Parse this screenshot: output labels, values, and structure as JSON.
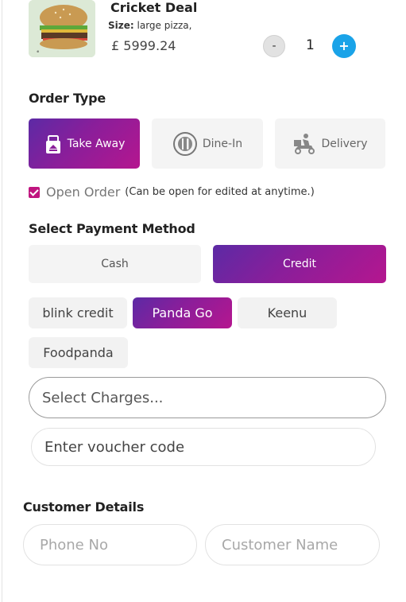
{
  "product": {
    "name": "Cricket Deal",
    "size_label": "Size:",
    "size_value": "large pizza,",
    "price": "£ 5999.24",
    "quantity": "1",
    "minus_label": "-",
    "plus_label": "+"
  },
  "order_type": {
    "title": "Order Type",
    "options": [
      {
        "label": "Take Away",
        "icon": "takeaway-bag-icon",
        "active": true
      },
      {
        "label": "Dine-In",
        "icon": "plate-fork-knife-icon",
        "active": false
      },
      {
        "label": "Delivery",
        "icon": "delivery-scooter-icon",
        "active": false
      }
    ]
  },
  "open_order": {
    "checked": true,
    "label": "Open Order",
    "note": "(Can be open for edited at anytime.)"
  },
  "payment": {
    "title": "Select Payment Method",
    "methods": [
      {
        "label": "Cash",
        "active": false
      },
      {
        "label": "Credit",
        "active": true
      }
    ],
    "credit_options": [
      {
        "label": "blink credit",
        "active": false
      },
      {
        "label": "Panda Go",
        "active": true
      },
      {
        "label": "Keenu",
        "active": false
      },
      {
        "label": "Foodpanda",
        "active": false
      }
    ]
  },
  "charges": {
    "placeholder": "Select Charges..."
  },
  "voucher": {
    "placeholder": "Enter voucher code"
  },
  "customer": {
    "title": "Customer Details",
    "phone_placeholder": "Phone No",
    "name_placeholder": "Customer Name"
  },
  "colors": {
    "accent_start": "#5c2aa5",
    "accent_end": "#b5168f",
    "plus_button": "#1aa3e8",
    "checkbox": "#c0157f"
  }
}
